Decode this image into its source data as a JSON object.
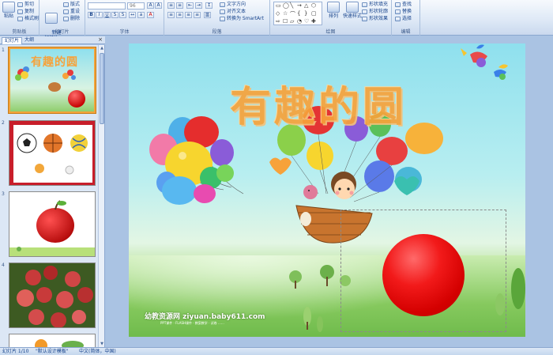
{
  "ribbon": {
    "clipboard": {
      "label": "剪贴板",
      "paste": "粘贴",
      "cut": "剪切",
      "copy": "复制",
      "format_painter": "格式刷"
    },
    "slides": {
      "label": "幻灯片",
      "new_slide": "新建\n幻灯片",
      "layout": "版式",
      "reset": "重设",
      "delete": "删除"
    },
    "font": {
      "label": "字体",
      "size": "96"
    },
    "paragraph": {
      "label": "段落",
      "text_direction": "文字方向",
      "align_text": "对齐文本",
      "convert_smartart": "转换为 SmartArt"
    },
    "drawing": {
      "label": "绘图",
      "arrange": "排列",
      "quick_styles": "快速样式",
      "shape_fill": "形状填充",
      "shape_outline": "形状轮廓",
      "shape_effects": "形状效果"
    },
    "editing": {
      "label": "编辑",
      "find": "查找",
      "replace": "替换",
      "select": "选择"
    }
  },
  "pane": {
    "tab_slides": "幻灯片",
    "tab_outline": "大纲",
    "close": "×"
  },
  "thumbnails": [
    {
      "num": "1",
      "title": "有趣的圆"
    },
    {
      "num": "2"
    },
    {
      "num": "3"
    },
    {
      "num": "4"
    }
  ],
  "slide": {
    "title": "有趣的圆",
    "watermark": "幼教资源网 ziyuan.baby611.com",
    "watermark_sub": "PPT课件 · FLASH课件 · 教案教学 · 试卷 ……"
  },
  "status": {
    "slide_info": "幻灯片 1/10",
    "theme": "\"默认设计模板\"",
    "language": "中文(简体，中国)"
  },
  "colors": {
    "title": "#f7a23a",
    "ball": "#e30d0d",
    "selected_thumb_border": "#f2a33a"
  }
}
